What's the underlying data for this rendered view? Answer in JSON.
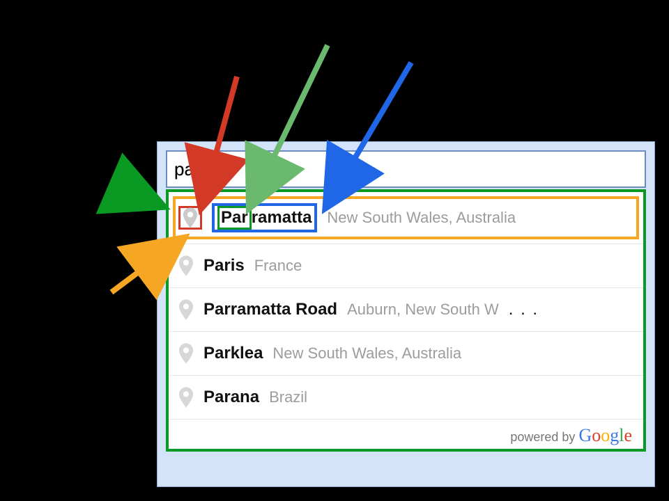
{
  "search": {
    "value": "par",
    "placeholder": ""
  },
  "suggestions": [
    {
      "matched": "Par",
      "rest": "ramatta",
      "secondary": "New South Wales, Australia",
      "highlighted": true
    },
    {
      "matched": "Par",
      "rest": "is",
      "secondary": "France"
    },
    {
      "matched": "Par",
      "rest": "ramatta Road",
      "secondary": "Auburn, New South W",
      "truncated": true
    },
    {
      "matched": "Par",
      "rest": "klea",
      "secondary": "New South Wales, Australia"
    },
    {
      "matched": "Par",
      "rest": "ana",
      "secondary": "Brazil"
    }
  ],
  "footer": {
    "prefix": "powered by",
    "brand": "Google"
  },
  "annotations": {
    "arrow_colors": {
      "green_container": "#0a9a24",
      "orange_row": "#f5a623",
      "red_icon": "#d23a27",
      "green_query": "#3aa648",
      "blue_match": "#1f67e6"
    }
  }
}
